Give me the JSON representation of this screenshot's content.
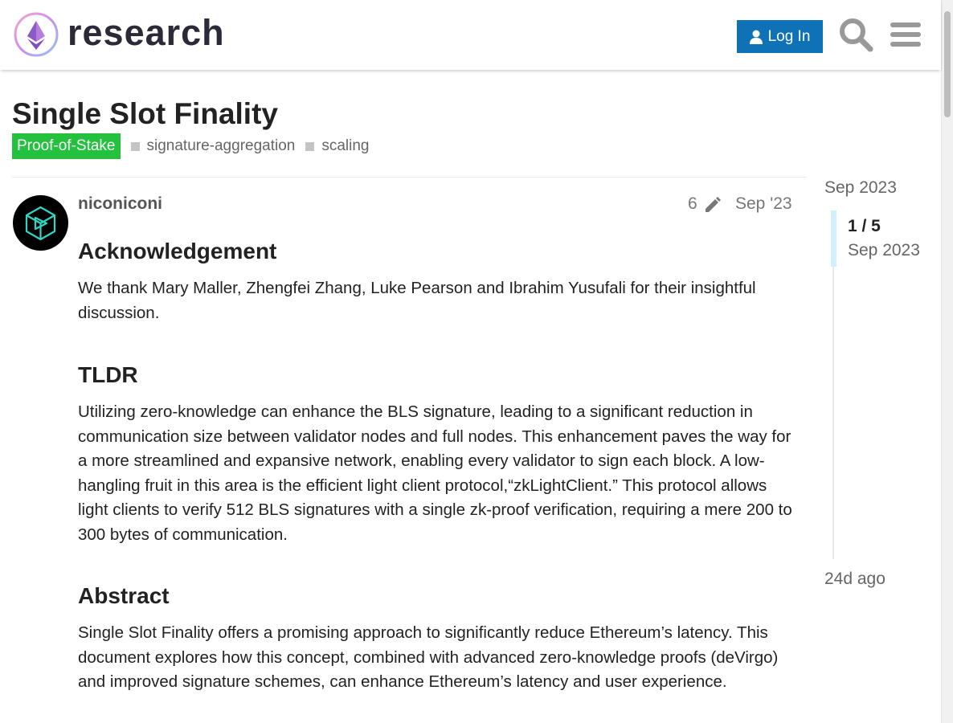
{
  "header": {
    "site_name": "research",
    "login_label": "Log In"
  },
  "topic": {
    "title": "Single Slot Finality",
    "category": "Proof-of-Stake",
    "tags": [
      "signature-aggregation",
      "scaling"
    ]
  },
  "post": {
    "username": "niconiconi",
    "edit_count": "6",
    "date": "Sep '23",
    "sections": {
      "ack_heading": "Acknowledgement",
      "ack_text": "We thank Mary Maller, Zhengfei Zhang, Luke Pearson and Ibrahim Yusufali for their insightful discussion.",
      "tldr_heading": "TLDR",
      "tldr_text": "Utilizing zero-knowledge can enhance the BLS signature, leading to a significant reduction in communication size between validator nodes and full nodes. This enhancement paves the way for a more streamlined and expansive network, enabling every validator to sign each block. A low-hangling fruit in this area is the efficient light client protocol,“zkLightClient.” This protocol allows light clients to verify 512 BLS signatures with a single zk-proof verification, requiring a mere 200 to 300 bytes of communication.",
      "abstract_heading": "Abstract",
      "abstract_text": "Single Slot Finality offers a promising approach to significantly reduce Ethereum’s latency. This document explores how this concept, combined with advanced zero-knowledge proofs (deVirgo) and improved signature schemes, can enhance Ethereum’s latency and user experience."
    }
  },
  "timeline": {
    "start_date": "Sep 2023",
    "position": "1 / 5",
    "position_date": "Sep 2023",
    "end_label": "24d ago"
  },
  "colors": {
    "login_bg": "#0f72b6",
    "category_bg": "#23c13e",
    "timeline_handle": "#d1f0ff"
  },
  "icons": [
    "logo-icon",
    "user-icon",
    "search-icon",
    "hamburger-menu-icon",
    "pencil-icon",
    "avatar"
  ]
}
